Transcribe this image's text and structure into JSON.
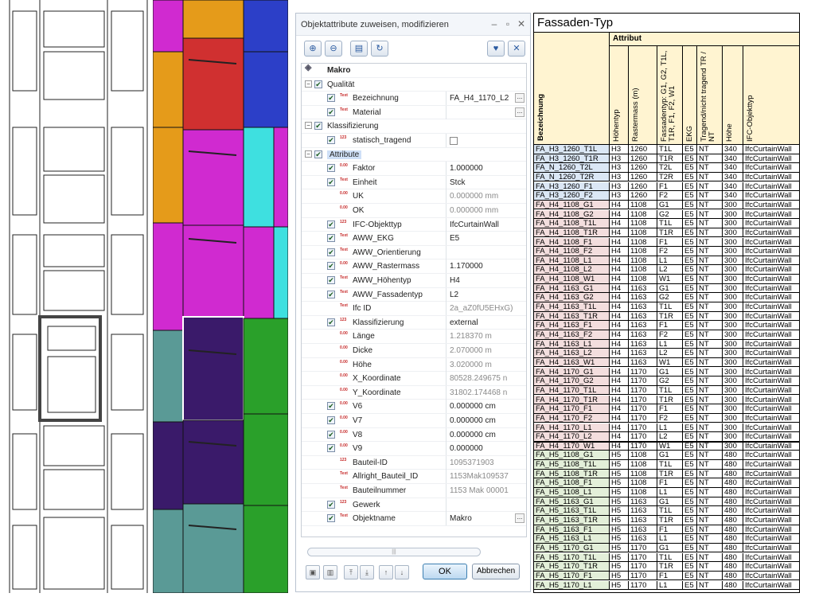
{
  "dialog": {
    "title": "Objektattribute zuweisen, modifizieren",
    "buttons": {
      "ok": "OK",
      "cancel": "Abbrechen"
    },
    "rows": [
      {
        "level": 0,
        "expander": "",
        "checkbox": false,
        "icon": "macro-icon",
        "name": "Makro",
        "value": "",
        "bold": true
      },
      {
        "level": 0,
        "expander": "−",
        "checkbox": true,
        "icon": "",
        "name": "Qualität",
        "value": ""
      },
      {
        "level": 1,
        "expander": "",
        "checkbox": true,
        "icon": "text-icon",
        "name": "Bezeichnung",
        "value": "FA_H4_1170_L2",
        "dots": true
      },
      {
        "level": 1,
        "expander": "",
        "checkbox": true,
        "icon": "text-icon",
        "name": "Material",
        "value": "",
        "dots": true
      },
      {
        "level": 0,
        "expander": "−",
        "checkbox": true,
        "icon": "",
        "name": "Klassifizierung",
        "value": ""
      },
      {
        "level": 1,
        "expander": "",
        "checkbox": true,
        "icon": "int-icon",
        "name": "statisch_tragend",
        "value": "",
        "box": true
      },
      {
        "level": 0,
        "expander": "−",
        "checkbox": true,
        "icon": "",
        "name": "Attribute",
        "value": "",
        "selected": true
      },
      {
        "level": 1,
        "expander": "",
        "checkbox": true,
        "icon": "float-icon",
        "name": "Faktor",
        "value": "1.000000"
      },
      {
        "level": 1,
        "expander": "",
        "checkbox": true,
        "icon": "text-icon",
        "name": "Einheit",
        "value": "Stck"
      },
      {
        "level": 1,
        "expander": "",
        "checkbox": false,
        "icon": "float-icon",
        "name": "UK",
        "value": "0.000000 mm",
        "ro": true
      },
      {
        "level": 1,
        "expander": "",
        "checkbox": false,
        "icon": "float-icon",
        "name": "OK",
        "value": "0.000000 mm",
        "ro": true
      },
      {
        "level": 1,
        "expander": "",
        "checkbox": true,
        "icon": "int-icon",
        "name": "IFC-Objekttyp",
        "value": "IfcCurtainWall"
      },
      {
        "level": 1,
        "expander": "",
        "checkbox": true,
        "icon": "text-icon",
        "name": "AWW_EKG",
        "value": "E5"
      },
      {
        "level": 1,
        "expander": "",
        "checkbox": true,
        "icon": "text-icon",
        "name": "AWW_Orientierung",
        "value": ""
      },
      {
        "level": 1,
        "expander": "",
        "checkbox": true,
        "icon": "float-icon",
        "name": "AWW_Rastermass",
        "value": "1.170000"
      },
      {
        "level": 1,
        "expander": "",
        "checkbox": true,
        "icon": "text-icon",
        "name": "AWW_Höhentyp",
        "value": "H4"
      },
      {
        "level": 1,
        "expander": "",
        "checkbox": true,
        "icon": "text-icon",
        "name": "AWW_Fassadentyp",
        "value": "L2"
      },
      {
        "level": 1,
        "expander": "",
        "checkbox": false,
        "icon": "text-icon",
        "name": "Ifc ID",
        "value": "2a_aZ0fU5EHxG)",
        "ro": true
      },
      {
        "level": 1,
        "expander": "",
        "checkbox": true,
        "icon": "int-icon",
        "name": "Klassifizierung",
        "value": "external"
      },
      {
        "level": 1,
        "expander": "",
        "checkbox": false,
        "icon": "float-icon",
        "name": "Länge",
        "value": "1.218370 m",
        "ro": true
      },
      {
        "level": 1,
        "expander": "",
        "checkbox": false,
        "icon": "float-icon",
        "name": "Dicke",
        "value": "2.070000 m",
        "ro": true
      },
      {
        "level": 1,
        "expander": "",
        "checkbox": false,
        "icon": "float-icon",
        "name": "Höhe",
        "value": "3.020000 m",
        "ro": true
      },
      {
        "level": 1,
        "expander": "",
        "checkbox": false,
        "icon": "float-icon",
        "name": "X_Koordinate",
        "value": "80528.249675 n",
        "ro": true
      },
      {
        "level": 1,
        "expander": "",
        "checkbox": false,
        "icon": "float-icon",
        "name": "Y_Koordinate",
        "value": "31802.174468 n",
        "ro": true
      },
      {
        "level": 1,
        "expander": "",
        "checkbox": true,
        "icon": "float-icon",
        "name": "V6",
        "value": "0.000000 cm"
      },
      {
        "level": 1,
        "expander": "",
        "checkbox": true,
        "icon": "float-icon",
        "name": "V7",
        "value": "0.000000 cm"
      },
      {
        "level": 1,
        "expander": "",
        "checkbox": true,
        "icon": "float-icon",
        "name": "V8",
        "value": "0.000000 cm"
      },
      {
        "level": 1,
        "expander": "",
        "checkbox": true,
        "icon": "float-icon",
        "name": "V9",
        "value": "0.000000"
      },
      {
        "level": 1,
        "expander": "",
        "checkbox": false,
        "icon": "int-icon",
        "name": "Bauteil-ID",
        "value": "1095371903",
        "ro": true
      },
      {
        "level": 1,
        "expander": "",
        "checkbox": false,
        "icon": "text-icon",
        "name": "Allright_Bauteil_ID",
        "value": "1153Mak109537",
        "ro": true
      },
      {
        "level": 1,
        "expander": "",
        "checkbox": false,
        "icon": "text-icon",
        "name": "Bauteilnummer",
        "value": "1153 Mak 00001",
        "ro": true
      },
      {
        "level": 1,
        "expander": "",
        "checkbox": true,
        "icon": "int-icon",
        "name": "Gewerk",
        "value": ""
      },
      {
        "level": 1,
        "expander": "",
        "checkbox": true,
        "icon": "text-icon",
        "name": "Objektname",
        "value": "Makro",
        "dots": true
      }
    ]
  },
  "table": {
    "title": "Fassaden-Typ",
    "attribut_label": "Attribut",
    "row_header": "Bezeichnung",
    "columns": [
      "Höhentyp",
      "Rastermass (m)",
      "Fassadentyp: G1, G2, T1L, T1R, F1, F2, W1",
      "EKG",
      "Tragend/nicht tragend TR / NT",
      "Höhe",
      "IFC-Objekttyp"
    ],
    "rows": [
      [
        "FA_H3_1260_T1L",
        "H3",
        "1260",
        "T1L",
        "E5",
        "NT",
        "340",
        "IfcCurtainWall"
      ],
      [
        "FA_H3_1260_T1R",
        "H3",
        "1260",
        "T1R",
        "E5",
        "NT",
        "340",
        "IfcCurtainWall"
      ],
      [
        "FA_N_1260_T2L",
        "H3",
        "1260",
        "T2L",
        "E5",
        "NT",
        "340",
        "IfcCurtainWall"
      ],
      [
        "FA_N_1260_T2R",
        "H3",
        "1260",
        "T2R",
        "E5",
        "NT",
        "340",
        "IfcCurtainWall"
      ],
      [
        "FA_H3_1260_F1",
        "H3",
        "1260",
        "F1",
        "E5",
        "NT",
        "340",
        "IfcCurtainWall"
      ],
      [
        "FA_H3_1260_F2",
        "H3",
        "1260",
        "F2",
        "E5",
        "NT",
        "340",
        "IfcCurtainWall"
      ],
      [
        "FA_H4_1108_G1",
        "H4",
        "1108",
        "G1",
        "E5",
        "NT",
        "300",
        "IfcCurtainWall"
      ],
      [
        "FA_H4_1108_G2",
        "H4",
        "1108",
        "G2",
        "E5",
        "NT",
        "300",
        "IfcCurtainWall"
      ],
      [
        "FA_H4_1108_T1L",
        "H4",
        "1108",
        "T1L",
        "E5",
        "NT",
        "300",
        "IfcCurtainWall"
      ],
      [
        "FA_H4_1108_T1R",
        "H4",
        "1108",
        "T1R",
        "E5",
        "NT",
        "300",
        "IfcCurtainWall"
      ],
      [
        "FA_H4_1108_F1",
        "H4",
        "1108",
        "F1",
        "E5",
        "NT",
        "300",
        "IfcCurtainWall"
      ],
      [
        "FA_H4_1108_F2",
        "H4",
        "1108",
        "F2",
        "E5",
        "NT",
        "300",
        "IfcCurtainWall"
      ],
      [
        "FA_H4_1108_L1",
        "H4",
        "1108",
        "L1",
        "E5",
        "NT",
        "300",
        "IfcCurtainWall"
      ],
      [
        "FA_H4_1108_L2",
        "H4",
        "1108",
        "L2",
        "E5",
        "NT",
        "300",
        "IfcCurtainWall"
      ],
      [
        "FA_H4_1108_W1",
        "H4",
        "1108",
        "W1",
        "E5",
        "NT",
        "300",
        "IfcCurtainWall"
      ],
      [
        "FA_H4_1163_G1",
        "H4",
        "1163",
        "G1",
        "E5",
        "NT",
        "300",
        "IfcCurtainWall"
      ],
      [
        "FA_H4_1163_G2",
        "H4",
        "1163",
        "G2",
        "E5",
        "NT",
        "300",
        "IfcCurtainWall"
      ],
      [
        "FA_H4_1163_T1L",
        "H4",
        "1163",
        "T1L",
        "E5",
        "NT",
        "300",
        "IfcCurtainWall"
      ],
      [
        "FA_H4_1163_T1R",
        "H4",
        "1163",
        "T1R",
        "E5",
        "NT",
        "300",
        "IfcCurtainWall"
      ],
      [
        "FA_H4_1163_F1",
        "H4",
        "1163",
        "F1",
        "E5",
        "NT",
        "300",
        "IfcCurtainWall"
      ],
      [
        "FA_H4_1163_F2",
        "H4",
        "1163",
        "F2",
        "E5",
        "NT",
        "300",
        "IfcCurtainWall"
      ],
      [
        "FA_H4_1163_L1",
        "H4",
        "1163",
        "L1",
        "E5",
        "NT",
        "300",
        "IfcCurtainWall"
      ],
      [
        "FA_H4_1163_L2",
        "H4",
        "1163",
        "L2",
        "E5",
        "NT",
        "300",
        "IfcCurtainWall"
      ],
      [
        "FA_H4_1163_W1",
        "H4",
        "1163",
        "W1",
        "E5",
        "NT",
        "300",
        "IfcCurtainWall"
      ],
      [
        "FA_H4_1170_G1",
        "H4",
        "1170",
        "G1",
        "E5",
        "NT",
        "300",
        "IfcCurtainWall"
      ],
      [
        "FA_H4_1170_G2",
        "H4",
        "1170",
        "G2",
        "E5",
        "NT",
        "300",
        "IfcCurtainWall"
      ],
      [
        "FA_H4_1170_T1L",
        "H4",
        "1170",
        "T1L",
        "E5",
        "NT",
        "300",
        "IfcCurtainWall"
      ],
      [
        "FA_H4_1170_T1R",
        "H4",
        "1170",
        "T1R",
        "E5",
        "NT",
        "300",
        "IfcCurtainWall"
      ],
      [
        "FA_H4_1170_F1",
        "H4",
        "1170",
        "F1",
        "E5",
        "NT",
        "300",
        "IfcCurtainWall"
      ],
      [
        "FA_H4_1170_F2",
        "H4",
        "1170",
        "F2",
        "E5",
        "NT",
        "300",
        "IfcCurtainWall"
      ],
      [
        "FA_H4_1170_L1",
        "H4",
        "1170",
        "L1",
        "E5",
        "NT",
        "300",
        "IfcCurtainWall"
      ],
      [
        "FA_H4_1170_L2",
        "H4",
        "1170",
        "L2",
        "E5",
        "NT",
        "300",
        "IfcCurtainWall"
      ],
      [
        "FA_H4_1170_W1",
        "H4",
        "1170",
        "W1",
        "E5",
        "NT",
        "300",
        "IfcCurtainWall"
      ],
      [
        "FA_H5_1108_G1",
        "H5",
        "1108",
        "G1",
        "E5",
        "NT",
        "480",
        "IfcCurtainWall"
      ],
      [
        "FA_H5_1108_T1L",
        "H5",
        "1108",
        "T1L",
        "E5",
        "NT",
        "480",
        "IfcCurtainWall"
      ],
      [
        "FA_H5_1108_T1R",
        "H5",
        "1108",
        "T1R",
        "E5",
        "NT",
        "480",
        "IfcCurtainWall"
      ],
      [
        "FA_H5_1108_F1",
        "H5",
        "1108",
        "F1",
        "E5",
        "NT",
        "480",
        "IfcCurtainWall"
      ],
      [
        "FA_H5_1108_L1",
        "H5",
        "1108",
        "L1",
        "E5",
        "NT",
        "480",
        "IfcCurtainWall"
      ],
      [
        "FA_H5_1163_G1",
        "H5",
        "1163",
        "G1",
        "E5",
        "NT",
        "480",
        "IfcCurtainWall"
      ],
      [
        "FA_H5_1163_T1L",
        "H5",
        "1163",
        "T1L",
        "E5",
        "NT",
        "480",
        "IfcCurtainWall"
      ],
      [
        "FA_H5_1163_T1R",
        "H5",
        "1163",
        "T1R",
        "E5",
        "NT",
        "480",
        "IfcCurtainWall"
      ],
      [
        "FA_H5_1163_F1",
        "H5",
        "1163",
        "F1",
        "E5",
        "NT",
        "480",
        "IfcCurtainWall"
      ],
      [
        "FA_H5_1163_L1",
        "H5",
        "1163",
        "L1",
        "E5",
        "NT",
        "480",
        "IfcCurtainWall"
      ],
      [
        "FA_H5_1170_G1",
        "H5",
        "1170",
        "G1",
        "E5",
        "NT",
        "480",
        "IfcCurtainWall"
      ],
      [
        "FA_H5_1170_T1L",
        "H5",
        "1170",
        "T1L",
        "E5",
        "NT",
        "480",
        "IfcCurtainWall"
      ],
      [
        "FA_H5_1170_T1R",
        "H5",
        "1170",
        "T1R",
        "E5",
        "NT",
        "480",
        "IfcCurtainWall"
      ],
      [
        "FA_H5_1170_F1",
        "H5",
        "1170",
        "F1",
        "E5",
        "NT",
        "480",
        "IfcCurtainWall"
      ],
      [
        "FA_H5_1170_L1",
        "H5",
        "1170",
        "L1",
        "E5",
        "NT",
        "480",
        "IfcCurtainWall"
      ]
    ],
    "row_colors": {
      "H3": "#dbe7f5",
      "H4": "#f3dede",
      "H5": "#e3efd9"
    }
  }
}
